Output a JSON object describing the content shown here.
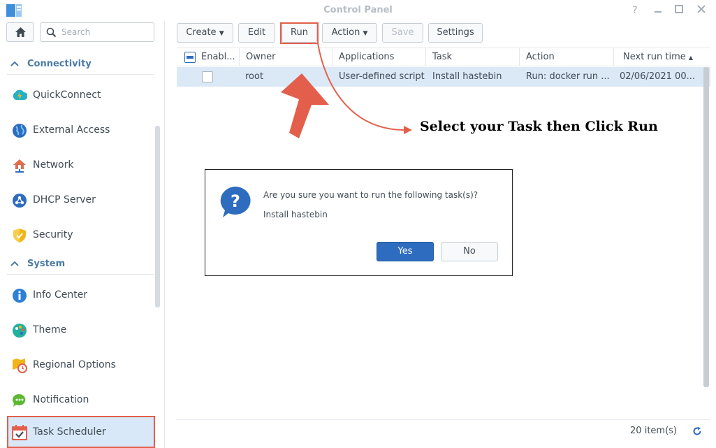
{
  "window": {
    "title": "Control Panel",
    "controls": [
      "help-icon",
      "minimize-icon",
      "maximize-icon",
      "close-icon"
    ]
  },
  "sidebar": {
    "search_placeholder": "Search",
    "sections": [
      {
        "title": "Connectivity",
        "items": [
          {
            "label": "QuickConnect",
            "icon": "quickconnect-icon",
            "color": "#23b0c9"
          },
          {
            "label": "External Access",
            "icon": "globe-icon",
            "color": "#2e6cbf"
          },
          {
            "label": "Network",
            "icon": "house-network-icon",
            "color": "#e26d4f"
          },
          {
            "label": "DHCP Server",
            "icon": "dhcp-icon",
            "color": "#2e6cbf"
          },
          {
            "label": "Security",
            "icon": "shield-icon",
            "color": "#f0b51a"
          }
        ]
      },
      {
        "title": "System",
        "items": [
          {
            "label": "Info Center",
            "icon": "info-icon",
            "color": "#2e80d6"
          },
          {
            "label": "Theme",
            "icon": "palette-icon",
            "color": "#23b0a0"
          },
          {
            "label": "Regional Options",
            "icon": "clock-map-icon",
            "color": "#f0b51a"
          },
          {
            "label": "Notification",
            "icon": "chat-bubble-icon",
            "color": "#5cb832"
          },
          {
            "label": "Task Scheduler",
            "icon": "calendar-check-icon",
            "color": "#e35f4b"
          }
        ]
      }
    ]
  },
  "toolbar": {
    "create": "Create",
    "edit": "Edit",
    "run": "Run",
    "action": "Action",
    "save": "Save",
    "settings": "Settings"
  },
  "grid": {
    "columns": [
      "Enabl...",
      "Owner",
      "Applications",
      "Task",
      "Action",
      "Next run time"
    ],
    "rows": [
      {
        "enabled": false,
        "owner": "root",
        "application": "User-defined script",
        "task": "Install hastebin",
        "action": "Run: docker run ...",
        "next_run": "02/06/2021 00..."
      }
    ]
  },
  "footer": {
    "count": "20 item(s)"
  },
  "annotation": {
    "text": "Select your Task then Click Run",
    "color": "#e35f4b"
  },
  "dialog": {
    "message": "Are you sure you want to run the following task(s)?",
    "task_name": "Install hastebin",
    "yes": "Yes",
    "no": "No"
  }
}
